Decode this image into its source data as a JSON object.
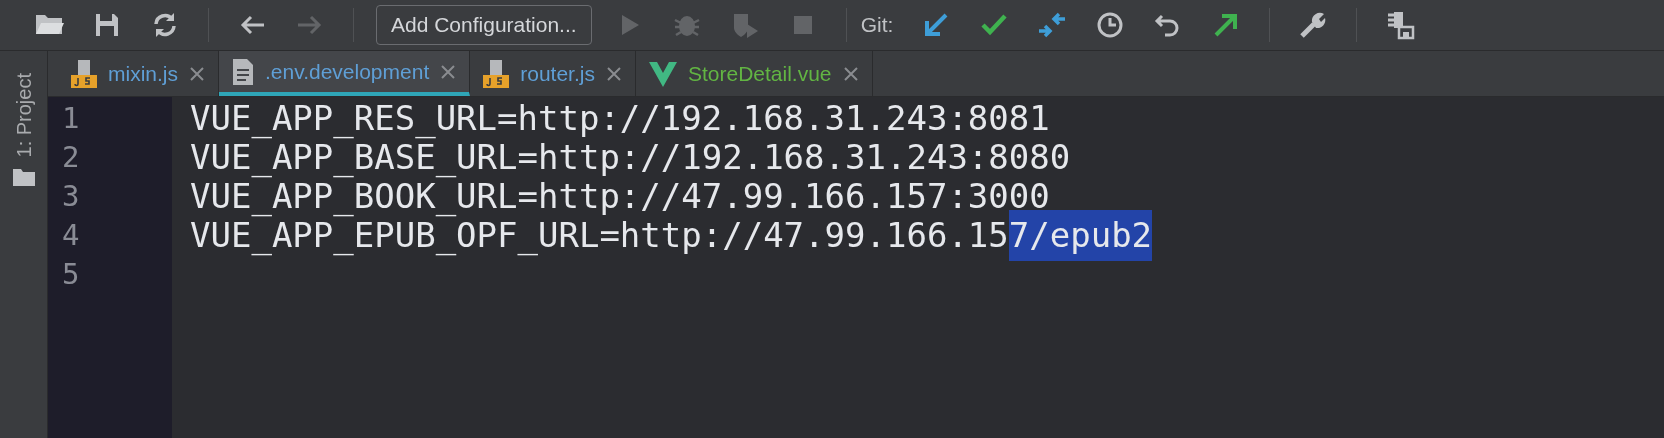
{
  "toolbar": {
    "items": [
      {
        "kind": "icon",
        "disabled": false
      },
      {
        "kind": "icon",
        "disabled": false
      },
      {
        "kind": "icon",
        "disabled": false
      },
      {
        "kind": "separator"
      },
      {
        "kind": "icon",
        "disabled": false
      },
      {
        "kind": "icon",
        "disabled": true
      },
      {
        "kind": "separator"
      },
      {
        "kind": "button",
        "label": "Add Configuration..."
      },
      {
        "kind": "icon",
        "disabled": true
      },
      {
        "kind": "icon",
        "disabled": true
      },
      {
        "kind": "icon",
        "disabled": true
      },
      {
        "kind": "icon",
        "disabled": true
      },
      {
        "kind": "separator"
      },
      {
        "kind": "label",
        "label": "Git:"
      },
      {
        "kind": "icon",
        "disabled": false
      },
      {
        "kind": "icon",
        "disabled": false
      },
      {
        "kind": "icon",
        "disabled": false
      },
      {
        "kind": "icon",
        "disabled": false
      },
      {
        "kind": "icon",
        "disabled": false
      },
      {
        "kind": "icon",
        "disabled": false
      },
      {
        "kind": "separator"
      },
      {
        "kind": "icon",
        "disabled": false
      },
      {
        "kind": "separator"
      },
      {
        "kind": "icon",
        "disabled": false
      }
    ]
  },
  "side_panel": {
    "label": "1: Project"
  },
  "tabs": [
    {
      "label": "mixin.js",
      "kind": "js",
      "color": "#5f9fd6",
      "selected": false
    },
    {
      "label": ".env.development",
      "kind": "file",
      "color": "#5f9fd6",
      "selected": true
    },
    {
      "label": "router.js",
      "kind": "js",
      "color": "#5f9fd6",
      "selected": false
    },
    {
      "label": "StoreDetail.vue",
      "kind": "vue",
      "color": "#62b543",
      "selected": false
    }
  ],
  "editor": {
    "lines": [
      {
        "number": "1",
        "segments": [
          {
            "text": "VUE_APP_RES_URL=http://192.168.31.243:8081",
            "selected": false
          }
        ]
      },
      {
        "number": "2",
        "segments": [
          {
            "text": "VUE_APP_BASE_URL=http://192.168.31.243:8080",
            "selected": false
          }
        ]
      },
      {
        "number": "3",
        "segments": [
          {
            "text": "VUE_APP_BOOK_URL=http://47.99.166.157:3000",
            "selected": false
          }
        ]
      },
      {
        "number": "4",
        "segments": [
          {
            "text": "VUE_APP_EPUB_OPF_URL=http://47.99.166.15",
            "selected": false
          },
          {
            "text": "7/epub2",
            "selected": true
          }
        ]
      },
      {
        "number": "5"
      }
    ]
  }
}
